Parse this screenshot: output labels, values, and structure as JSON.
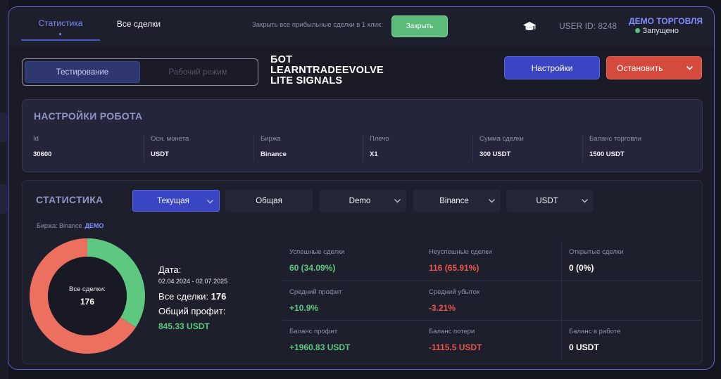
{
  "header": {
    "tab_stats": "Статистика",
    "tab_all_trades": "Все сделки",
    "close_hint": "Закрыть все прибыльные сделки в 1 клик:",
    "close_button": "Закрыть",
    "user_id": "USER ID: 8248",
    "account_mode": "ДЕМО ТОРГОВЛЯ",
    "account_status": "Запущено"
  },
  "controls": {
    "mode_testing": "Тестирование",
    "mode_live": "Рабочий режим",
    "bot_name_line1": "БОТ",
    "bot_name_line2": "LEARNTRADEEVOLVE",
    "bot_name_line3": "LITE SIGNALS",
    "settings_button": "Настройки",
    "stop_button": "Остановить"
  },
  "robot_settings": {
    "title": "НАСТРОЙКИ РОБОТА",
    "fields": [
      {
        "label": "Id",
        "value": "30600"
      },
      {
        "label": "Осн. монета",
        "value": "USDT"
      },
      {
        "label": "Биржа",
        "value": "Binance"
      },
      {
        "label": "Плечо",
        "value": "X1"
      },
      {
        "label": "Сумма сделки",
        "value": "300 USDT"
      },
      {
        "label": "Баланс торговли",
        "value": "1500 USDT"
      }
    ]
  },
  "statistics": {
    "title": "СТАТИСТИКА",
    "filters": [
      "Текущая",
      "Общая",
      "Demo",
      "Binance",
      "USDT"
    ],
    "exchange_label": "Биржа: Binance",
    "exchange_mode": "ДЕМО",
    "donut_label": "Все сделки:",
    "donut_value": "176",
    "date_label": "Дата:",
    "date_range": "02.04.2024 - 02.07.2025",
    "total_trades_label": "Все сделки:",
    "total_trades_value": "176",
    "total_profit_label": "Общий профит:",
    "total_profit_value": "845.33 USDT",
    "metrics": [
      {
        "label": "Успешные сделки",
        "value": "60 (34.09%)"
      },
      {
        "label": "Неуспешные сделки",
        "value": "116 (65.91%)"
      },
      {
        "label": "Открытые сделки",
        "value": "0 (0%)"
      },
      {
        "label": "Средний профит",
        "value": "+10.9%"
      },
      {
        "label": "Средний убыток",
        "value": "-3.21%"
      },
      {
        "label": "Баланс профит",
        "value": "+1960.83 USDT"
      },
      {
        "label": "Баланс потери",
        "value": "-1115.5 USDT"
      },
      {
        "label": "Баланс в работе",
        "value": "0 USDT"
      }
    ]
  },
  "chart_data": {
    "type": "pie",
    "categories": [
      "Успешные сделки",
      "Неуспешные сделки"
    ],
    "values": [
      60,
      116
    ],
    "colors": [
      "#5ec780",
      "#ec6f60"
    ]
  },
  "colors": {
    "accent": "#3b45c4",
    "success": "#5ec780",
    "danger": "#e8564a",
    "stop": "#d44b3d"
  }
}
